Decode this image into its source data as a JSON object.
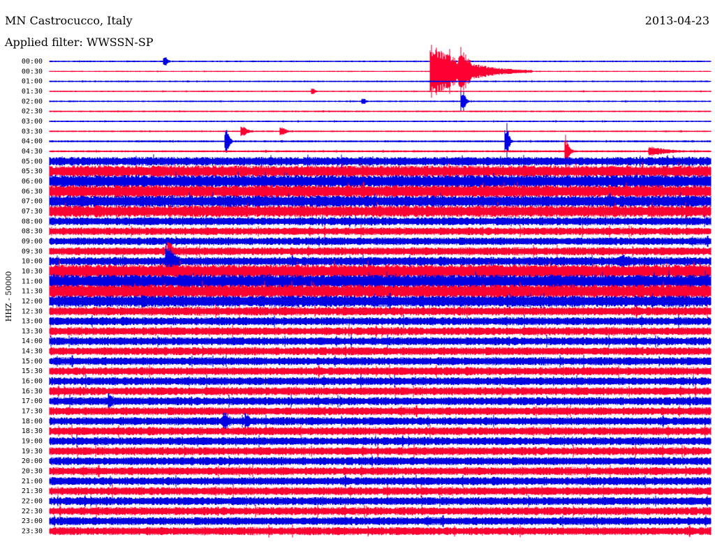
{
  "header": {
    "station": "MN Castrocucco, Italy",
    "date": "2013-04-23",
    "filter": "Applied filter: WWSSN-SP"
  },
  "axis": {
    "ylabel": "HHZ - 50000"
  },
  "chart_data": {
    "type": "line",
    "title": "MN Castrocucco, Italy",
    "date": "2013-04-23",
    "filter": "WWSSN-SP",
    "ylabel": "HHZ - 50000",
    "x_units": "minutes within 30-minute row",
    "xlim": [
      0,
      30
    ],
    "grid": false,
    "colors": [
      "#0000e0",
      "#ff0033"
    ],
    "rows": [
      {
        "label": "00:00",
        "amp": 0.08
      },
      {
        "label": "00:30",
        "amp": 0.06
      },
      {
        "label": "01:00",
        "amp": 0.08
      },
      {
        "label": "01:30",
        "amp": 0.07
      },
      {
        "label": "02:00",
        "amp": 0.08
      },
      {
        "label": "02:30",
        "amp": 0.08
      },
      {
        "label": "03:00",
        "amp": 0.08
      },
      {
        "label": "03:30",
        "amp": 0.08
      },
      {
        "label": "04:00",
        "amp": 0.1
      },
      {
        "label": "04:30",
        "amp": 0.1
      },
      {
        "label": "05:00",
        "amp": 0.45
      },
      {
        "label": "05:30",
        "amp": 0.6
      },
      {
        "label": "06:00",
        "amp": 0.65
      },
      {
        "label": "06:30",
        "amp": 0.65
      },
      {
        "label": "07:00",
        "amp": 0.6
      },
      {
        "label": "07:30",
        "amp": 0.6
      },
      {
        "label": "08:00",
        "amp": 0.42
      },
      {
        "label": "08:30",
        "amp": 0.4
      },
      {
        "label": "09:00",
        "amp": 0.4
      },
      {
        "label": "09:30",
        "amp": 0.42
      },
      {
        "label": "10:00",
        "amp": 0.45
      },
      {
        "label": "10:30",
        "amp": 0.7
      },
      {
        "label": "11:00",
        "amp": 0.7
      },
      {
        "label": "11:30",
        "amp": 0.7
      },
      {
        "label": "12:00",
        "amp": 0.6
      },
      {
        "label": "12:30",
        "amp": 0.45
      },
      {
        "label": "13:00",
        "amp": 0.42
      },
      {
        "label": "13:30",
        "amp": 0.42
      },
      {
        "label": "14:00",
        "amp": 0.42
      },
      {
        "label": "14:30",
        "amp": 0.42
      },
      {
        "label": "15:00",
        "amp": 0.42
      },
      {
        "label": "15:30",
        "amp": 0.42
      },
      {
        "label": "16:00",
        "amp": 0.42
      },
      {
        "label": "16:30",
        "amp": 0.42
      },
      {
        "label": "17:00",
        "amp": 0.42
      },
      {
        "label": "17:30",
        "amp": 0.42
      },
      {
        "label": "18:00",
        "amp": 0.42
      },
      {
        "label": "18:30",
        "amp": 0.42
      },
      {
        "label": "19:00",
        "amp": 0.42
      },
      {
        "label": "19:30",
        "amp": 0.42
      },
      {
        "label": "20:00",
        "amp": 0.42
      },
      {
        "label": "20:30",
        "amp": 0.42
      },
      {
        "label": "21:00",
        "amp": 0.42
      },
      {
        "label": "21:30",
        "amp": 0.42
      },
      {
        "label": "22:00",
        "amp": 0.42
      },
      {
        "label": "22:30",
        "amp": 0.42
      },
      {
        "label": "23:00",
        "amp": 0.42
      },
      {
        "label": "23:30",
        "amp": 0.42
      }
    ],
    "events": [
      {
        "row": "00:00",
        "minute": 5.3,
        "amp": 0.5,
        "dur": 0.3
      },
      {
        "row": "00:30",
        "minute": 17.4,
        "amp": 2.8,
        "dur": 4.5
      },
      {
        "row": "00:30",
        "minute": 18.7,
        "amp": 2.5,
        "dur": 1.5
      },
      {
        "row": "01:30",
        "minute": 12.0,
        "amp": 0.3,
        "dur": 0.3
      },
      {
        "row": "02:00",
        "minute": 18.8,
        "amp": 1.0,
        "dur": 0.3
      },
      {
        "row": "02:00",
        "minute": 14.3,
        "amp": 0.3,
        "dur": 0.3
      },
      {
        "row": "03:30",
        "minute": 8.8,
        "amp": 0.5,
        "dur": 0.8
      },
      {
        "row": "03:30",
        "minute": 10.6,
        "amp": 0.4,
        "dur": 0.6
      },
      {
        "row": "04:00",
        "minute": 8.1,
        "amp": 1.2,
        "dur": 0.3
      },
      {
        "row": "04:00",
        "minute": 20.8,
        "amp": 1.2,
        "dur": 0.3
      },
      {
        "row": "04:30",
        "minute": 23.5,
        "amp": 1.2,
        "dur": 0.4
      },
      {
        "row": "04:30",
        "minute": 27.3,
        "amp": 0.5,
        "dur": 3.0
      },
      {
        "row": "09:30",
        "minute": 5.5,
        "amp": 1.0,
        "dur": 0.6
      },
      {
        "row": "10:00",
        "minute": 5.4,
        "amp": 1.8,
        "dur": 1.2
      },
      {
        "row": "10:00",
        "minute": 26.0,
        "amp": 0.7,
        "dur": 4.0
      },
      {
        "row": "11:30",
        "minute": 4.0,
        "amp": 0.8,
        "dur": 2.0
      },
      {
        "row": "12:00",
        "minute": 4.0,
        "amp": 0.7,
        "dur": 8.0
      },
      {
        "row": "17:00",
        "minute": 2.8,
        "amp": 0.8,
        "dur": 0.6
      },
      {
        "row": "18:00",
        "minute": 8.0,
        "amp": 0.9,
        "dur": 1.0
      },
      {
        "row": "18:00",
        "minute": 9.0,
        "amp": 0.9,
        "dur": 0.6
      }
    ]
  }
}
